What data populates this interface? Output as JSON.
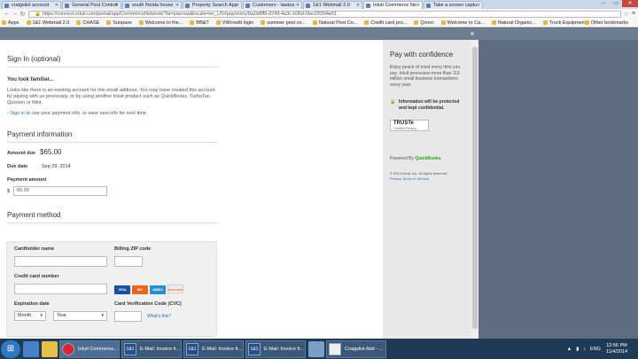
{
  "browser": {
    "tabs": [
      {
        "label": "craigslist account"
      },
      {
        "label": "General Pest Control"
      },
      {
        "label": "south florida house"
      },
      {
        "label": "Property Search App"
      },
      {
        "label": "Customers - lawtza"
      },
      {
        "label": "1&1 Webmail 2.0"
      },
      {
        "label": "Intuit Commerce Ne",
        "active": true
      },
      {
        "label": "Take a screen captu"
      }
    ],
    "url": "https://connect.intuit.com/portal/app/CommerceNetwork/?ta=paynow&locale=en_US#pay/entry/8a1b8ff9-d749-4a3c-b36d-5be22f394e61",
    "bookmarks": [
      "Apps",
      "1&1 Webmail 2.0",
      "CHASE",
      "Sunpass",
      "Welcome to the...",
      "BB&T",
      "VWcredit login",
      "summer pest co...",
      "Natural Pest Co...",
      "Credit card pro...",
      "Qvinci",
      "Welcome to Ca...",
      "Natural Organic...",
      "Truck Equipment"
    ],
    "other_bookmarks": "Other bookmarks"
  },
  "modal": {
    "close_glyph": "×"
  },
  "signin": {
    "title": "Sign In (optional)",
    "familiar_heading": "You look familiar...",
    "familiar_text": "Looks like there is an existing account for this email address. You may have created this account by paying with us previously, or by using another Intuit product such as QuickBooks, TurboTax, Quicken or Mint.",
    "signin_link": "Sign in",
    "signin_rest": "to use your payment info, or save new info for next time."
  },
  "payment_info": {
    "title": "Payment information",
    "amount_due_label": "Amount due",
    "amount_due_value": "$65.00",
    "due_date_label": "Due date",
    "due_date_value": "Sep 29, 2014",
    "payment_amount_label": "Payment amount",
    "currency_symbol": "$",
    "payment_amount_value": "65.00"
  },
  "payment_method": {
    "title": "Payment method",
    "cardholder_label": "Cardholder name",
    "zip_label": "Billing ZIP code",
    "card_number_label": "Credit card number",
    "cards": [
      {
        "name": "VISA",
        "color": "#1a4fa0"
      },
      {
        "name": "MC",
        "color": "#e5661e"
      },
      {
        "name": "AMEX",
        "color": "#2a8fd0"
      },
      {
        "name": "DISCOVER",
        "color": "#eeeeee"
      }
    ],
    "expiration_label": "Expiration date",
    "month_value": "Month",
    "year_value": "Year",
    "cvc_label": "Card Verification Code (CVC)",
    "whats_this": "What's this?"
  },
  "confidence": {
    "title": "Pay with confidence",
    "body": "Enjoy peace of mind every time you pay. Intuit processes more than 116 million small business transactions every year.",
    "protected": "Information will be protected and kept confidential.",
    "truste": "TRUSTe",
    "truste_sub": "Certified Privacy",
    "powered_by": "Powered By",
    "quickbooks": "QuickBooks",
    "copyright": "© 2013 Intuit, Inc. All rights reserved.",
    "privacy": "Privacy",
    "terms": "Terms of Service"
  },
  "taskbar": {
    "items": [
      "Intuit Commerce...",
      "E-Mail: Invoice fr...",
      "E-Mail: Invoice fr...",
      "E-Mail: Invoice fr...",
      "Craigslist Add - ..."
    ],
    "lang": "ENG",
    "time": "12:56 PM",
    "date": "11/4/2014"
  }
}
